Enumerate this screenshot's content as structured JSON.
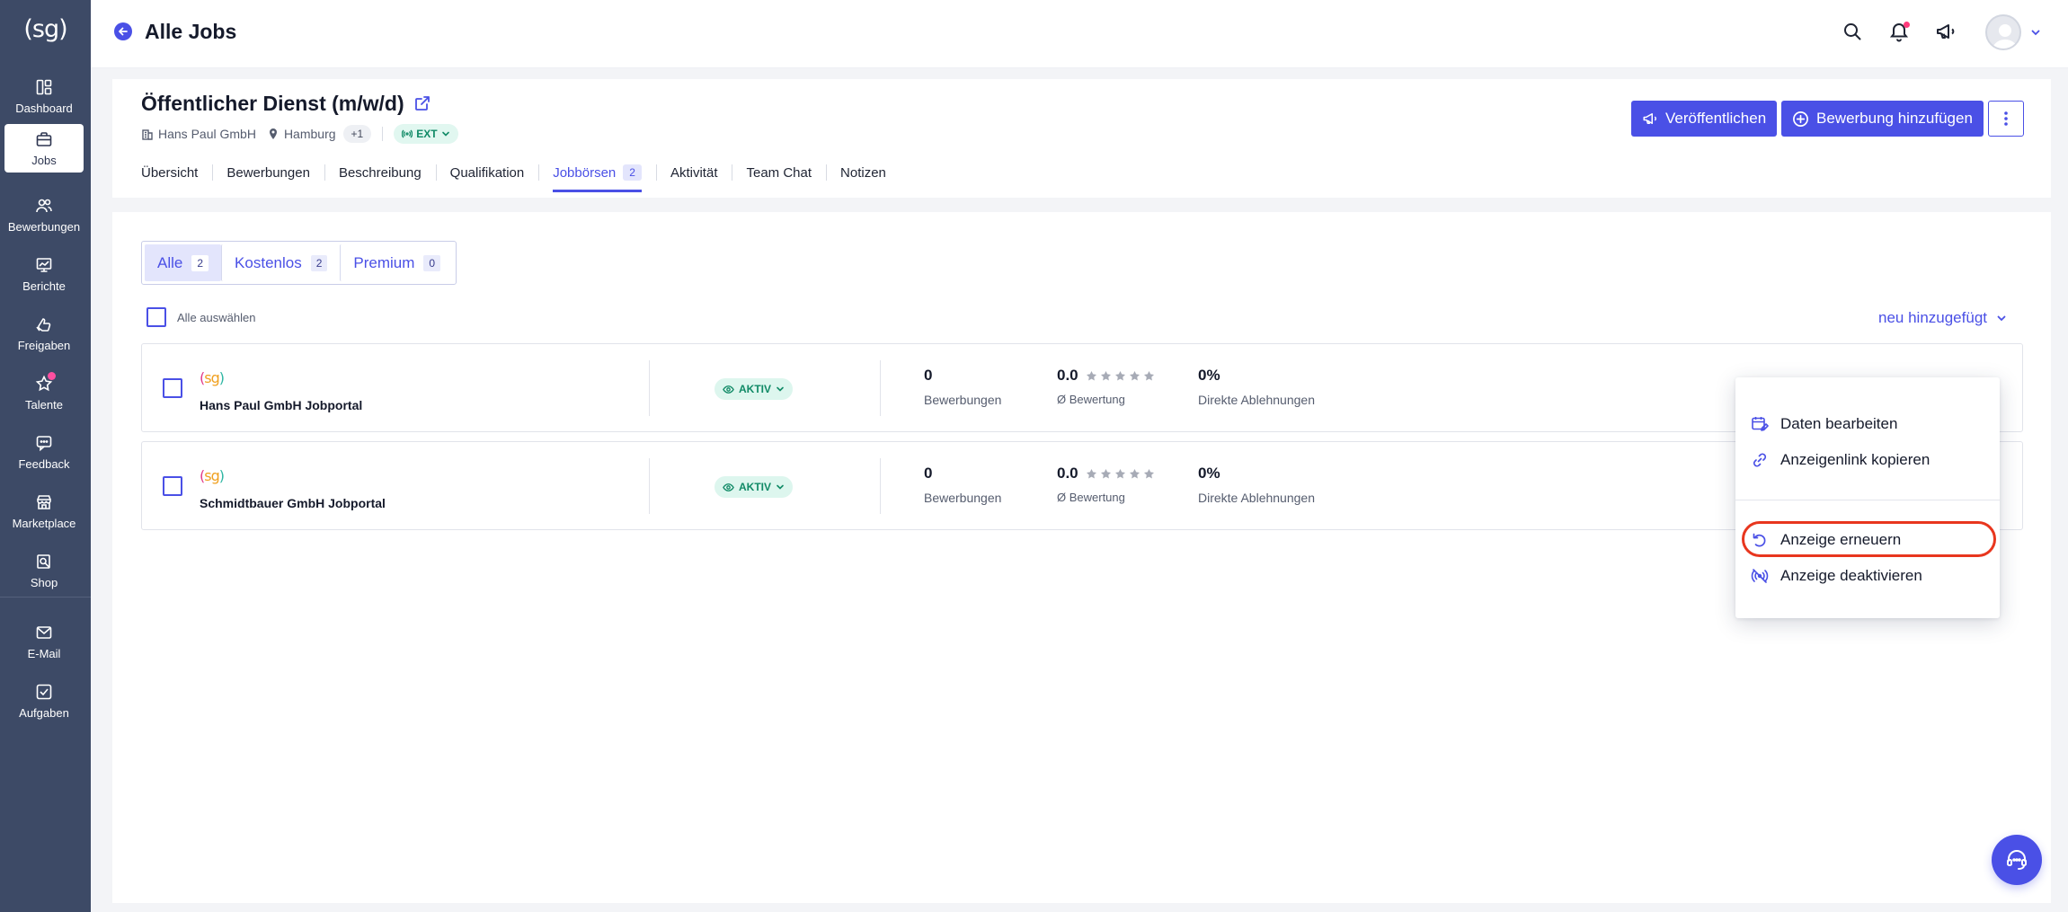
{
  "sidebar": {
    "logo": "(sg)",
    "items": [
      {
        "label": "Dashboard",
        "icon": "dashboard-icon"
      },
      {
        "label": "Jobs",
        "icon": "briefcase-icon"
      },
      {
        "label": "Bewerbungen",
        "icon": "users-icon"
      },
      {
        "label": "Berichte",
        "icon": "chart-icon"
      },
      {
        "label": "Freigaben",
        "icon": "thumbs-up-icon"
      },
      {
        "label": "Talente",
        "icon": "star-icon"
      },
      {
        "label": "Feedback",
        "icon": "feedback-icon"
      },
      {
        "label": "Marketplace",
        "icon": "store-icon"
      },
      {
        "label": "Shop",
        "icon": "shop-icon"
      },
      {
        "label": "E-Mail",
        "icon": "mail-icon"
      },
      {
        "label": "Aufgaben",
        "icon": "tasks-icon"
      }
    ],
    "active": "Jobs"
  },
  "topbar": {
    "title": "Alle Jobs"
  },
  "job": {
    "title": "Öffentlicher Dienst (m/w/d)",
    "company": "Hans Paul GmbH",
    "location": "Hamburg",
    "more_locations": "+1",
    "ext_badge": "EXT",
    "publish_label": "Veröffentlichen",
    "add_application_label": "Bewerbung hinzufügen",
    "tabs": [
      {
        "label": "Übersicht"
      },
      {
        "label": "Bewerbungen"
      },
      {
        "label": "Beschreibung"
      },
      {
        "label": "Qualifikation"
      },
      {
        "label": "Jobbörsen",
        "count": "2"
      },
      {
        "label": "Aktivität"
      },
      {
        "label": "Team Chat"
      },
      {
        "label": "Notizen"
      }
    ],
    "active_tab": "Jobbörsen"
  },
  "filters": {
    "segments": [
      {
        "label": "Alle",
        "count": "2"
      },
      {
        "label": "Kostenlos",
        "count": "2"
      },
      {
        "label": "Premium",
        "count": "0"
      }
    ],
    "active": "Alle",
    "select_all_label": "Alle auswählen",
    "sort_label": "neu hinzugefügt"
  },
  "jobboards": [
    {
      "name": "Hans Paul GmbH Jobportal",
      "status": "AKTIV",
      "applications": "0",
      "applications_label": "Bewerbungen",
      "rating": "0.0",
      "rating_label": "Ø Bewertung",
      "rating_stars": 0,
      "rejections": "0%",
      "rejections_label": "Direkte Ablehnungen"
    },
    {
      "name": "Schmidtbauer GmbH Jobportal",
      "status": "AKTIV",
      "applications": "0",
      "applications_label": "Bewerbungen",
      "rating": "0.0",
      "rating_label": "Ø Bewertung",
      "rating_stars": 0,
      "rejections": "0%",
      "rejections_label": "Direkte Ablehnungen"
    }
  ],
  "menu": {
    "items": [
      {
        "label": "Daten bearbeiten",
        "icon": "calendar-edit-icon"
      },
      {
        "label": "Anzeigenlink kopieren",
        "icon": "link-icon"
      },
      {
        "label": "Anzeige erneuern",
        "icon": "refresh-icon"
      },
      {
        "label": "Anzeige deaktivieren",
        "icon": "broadcast-off-icon"
      }
    ],
    "highlighted": "Anzeige erneuern"
  },
  "colors": {
    "sidebar": "#3d4a66",
    "accent": "#4a50e6",
    "status_green": "#108a66",
    "highlight": "#e8361e"
  }
}
